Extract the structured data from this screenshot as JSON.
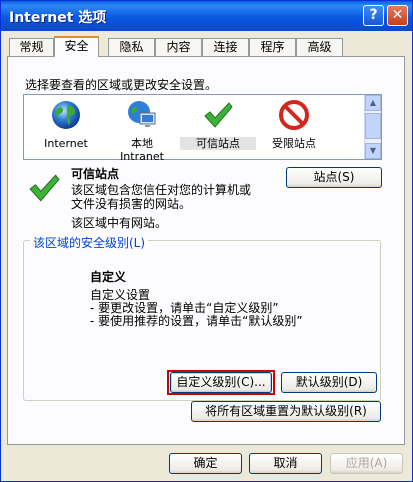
{
  "window": {
    "title": "Internet 选项",
    "help_glyph": "?",
    "close_glyph": "✕"
  },
  "tabs": [
    {
      "label": "常规"
    },
    {
      "label": "安全"
    },
    {
      "label": "隐私"
    },
    {
      "label": "内容"
    },
    {
      "label": "连接"
    },
    {
      "label": "程序"
    },
    {
      "label": "高级"
    }
  ],
  "security": {
    "zone_prompt": "选择要查看的区域或更改安全设置。",
    "zones": [
      {
        "label_1": "Internet",
        "label_2": "",
        "icon": "globe-icon"
      },
      {
        "label_1": "本地",
        "label_2": "Intranet",
        "icon": "local-intranet-icon"
      },
      {
        "label_1": "可信站点",
        "label_2": "",
        "icon": "checkmark-icon"
      },
      {
        "label_1": "受限站点",
        "label_2": "",
        "icon": "restricted-icon"
      }
    ],
    "selected_zone": {
      "title": "可信站点",
      "desc_line1": "该区域包含您信任对您的计算机或",
      "desc_line2": "文件没有损害的网站。",
      "note": "该区域中有网站。",
      "sites_button": "站点(S)"
    },
    "level_group": {
      "legend": "该区域的安全级别(L)",
      "level_name": "自定义",
      "line1": "自定义设置",
      "line2": "- 要更改设置，请单击“自定义级别”",
      "line3": "- 要使用推荐的设置，请单击“默认级别”",
      "custom_button": "自定义级别(C)...",
      "default_button": "默认级别(D)"
    },
    "reset_all_button": "将所有区域重置为默认级别(R)"
  },
  "footer": {
    "ok": "确定",
    "cancel": "取消",
    "apply": "应用(A)"
  },
  "colors": {
    "titlebar": "#0a5fdc",
    "highlight_box": "#cc0000",
    "legend": "#0046d5"
  }
}
